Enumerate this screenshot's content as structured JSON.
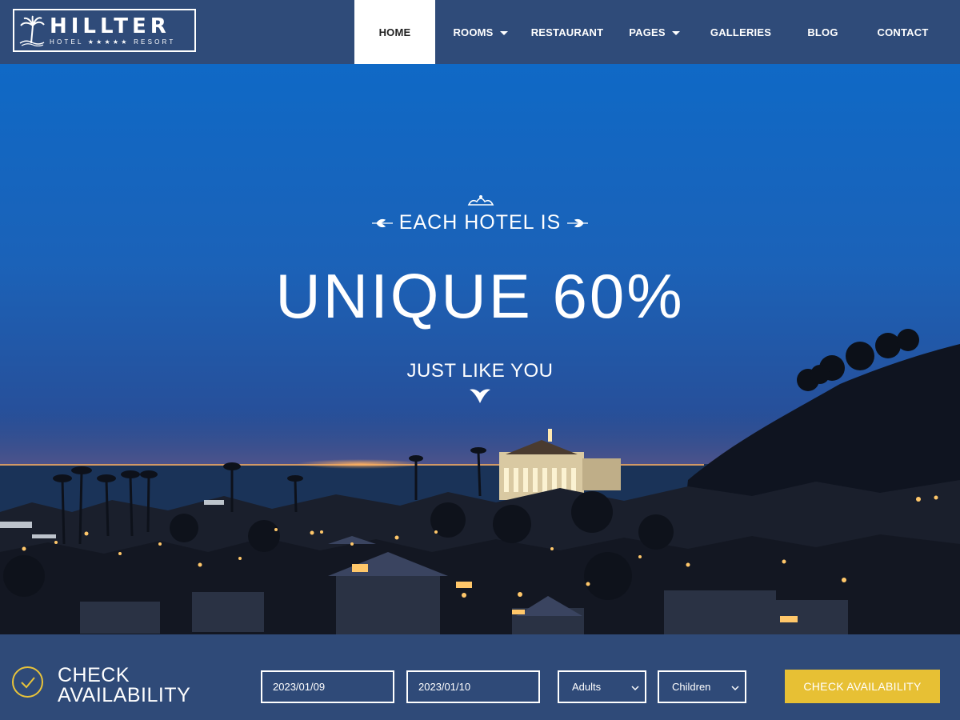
{
  "brand": {
    "name": "HILLTER",
    "tagline": "HOTEL ★★★★★ RESORT"
  },
  "nav": {
    "items": [
      {
        "label": "HOME",
        "active": true,
        "dropdown": false
      },
      {
        "label": "ROOMS",
        "active": false,
        "dropdown": true
      },
      {
        "label": "RESTAURANT",
        "active": false,
        "dropdown": false
      },
      {
        "label": "PAGES",
        "active": false,
        "dropdown": true
      },
      {
        "label": "GALLERIES",
        "active": false,
        "dropdown": false
      },
      {
        "label": "BLOG",
        "active": false,
        "dropdown": false
      },
      {
        "label": "CONTACT",
        "active": false,
        "dropdown": false
      }
    ]
  },
  "hero": {
    "eyebrow": "EACH HOTEL IS",
    "headline": "UNIQUE 60%",
    "subline": "JUST LIKE YOU"
  },
  "booking": {
    "title_line1": "CHECK",
    "title_line2": "AVAILABILITY",
    "check_in": "2023/01/09",
    "check_out": "2023/01/10",
    "adults": "Adults",
    "children": "Children",
    "button_label": "CHECK AVAILABILITY"
  },
  "colors": {
    "header_bg": "#2f4b79",
    "booking_bg": "#2f4a78",
    "accent_yellow": "#e7c034",
    "sky_blue": "#0f69c6"
  }
}
